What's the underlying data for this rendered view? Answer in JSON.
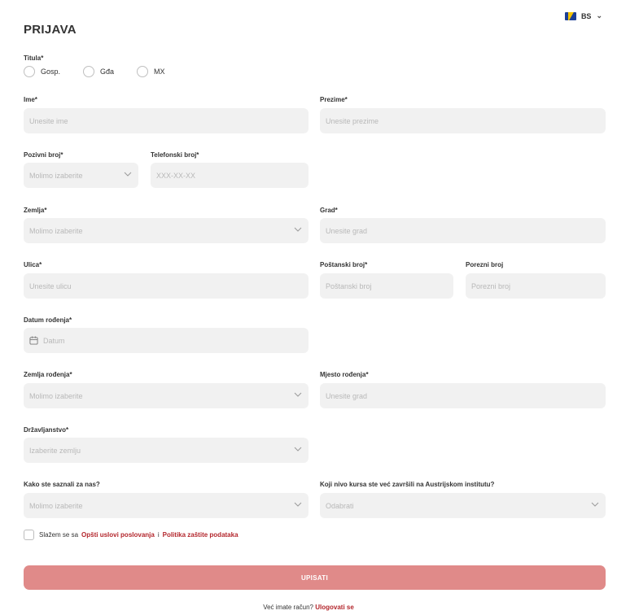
{
  "language": {
    "code": "BS"
  },
  "page_title": "PRIJAVA",
  "title_field": {
    "label": "Titula*",
    "options": [
      "Gosp.",
      "Gđa",
      "MX"
    ]
  },
  "first_name": {
    "label": "Ime*",
    "placeholder": "Unesite ime"
  },
  "last_name": {
    "label": "Prezime*",
    "placeholder": "Unesite prezime"
  },
  "dial_code": {
    "label": "Pozivni broj*",
    "placeholder": "Molimo izaberite"
  },
  "phone": {
    "label": "Telefonski broj*",
    "placeholder": "XXX-XX-XX"
  },
  "country": {
    "label": "Zemlja*",
    "placeholder": "Molimo izaberite"
  },
  "city": {
    "label": "Grad*",
    "placeholder": "Unesite grad"
  },
  "street": {
    "label": "Ulica*",
    "placeholder": "Unesite ulicu"
  },
  "postal_code": {
    "label": "Poštanski broj*",
    "placeholder": "Poštanski broj"
  },
  "tax_number": {
    "label": "Porezni broj",
    "placeholder": "Porezni broj"
  },
  "birth_date": {
    "label": "Datum rođenja*",
    "placeholder": "Datum"
  },
  "birth_country": {
    "label": "Zemlja rođenja*",
    "placeholder": "Molimo izaberite"
  },
  "birth_place": {
    "label": "Mjesto rođenja*",
    "placeholder": "Unesite grad"
  },
  "citizenship": {
    "label": "Državljanstvo*",
    "placeholder": "Izaberite zemlju"
  },
  "referral": {
    "label": "Kako ste saznali za nas?",
    "placeholder": "Molimo izaberite"
  },
  "course_level": {
    "label": "Koji nivo kursa ste već završili na Austrijskom institutu?",
    "placeholder": "Odabrati"
  },
  "agreement": {
    "prefix": "Slažem se sa",
    "terms_link": "Opšti uslovi poslovanja",
    "separator": "i",
    "privacy_link": "Politika zaštite podataka"
  },
  "submit_label": "UPISATI",
  "login": {
    "prompt": "Već imate račun?",
    "link": "Ulogovati se"
  }
}
